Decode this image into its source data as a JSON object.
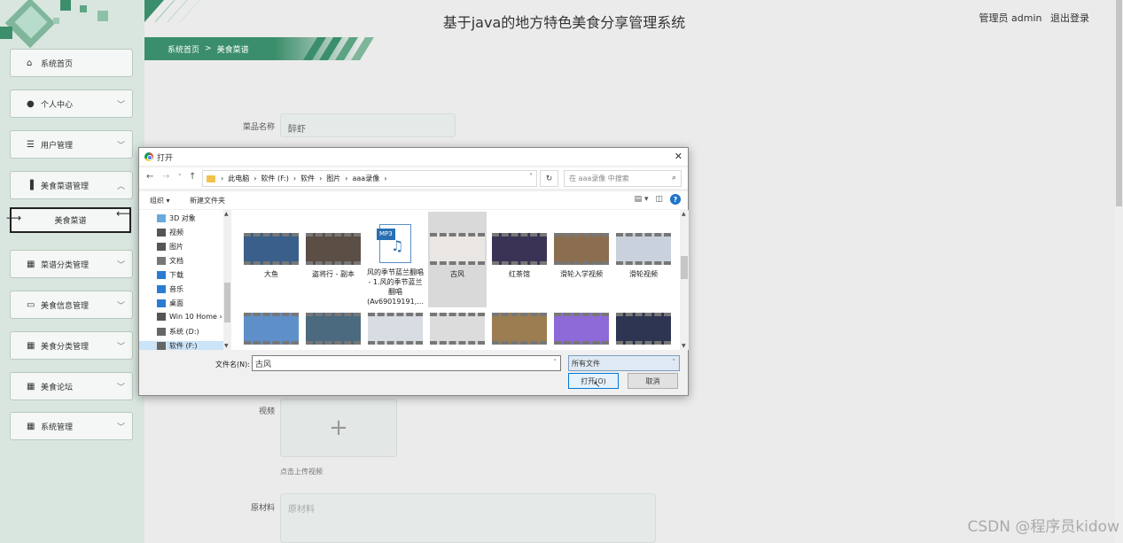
{
  "app": {
    "title": "基于java的地方特色美食分享管理系统",
    "user_role_text": "管理员 admin",
    "logout_label": "退出登录"
  },
  "breadcrumb": {
    "home": "系统首页",
    "separator": ">",
    "current": "美食菜谱"
  },
  "sidebar": {
    "items": [
      {
        "label": "系统首页",
        "icon": "home-icon"
      },
      {
        "label": "个人中心",
        "icon": "user-icon"
      },
      {
        "label": "用户管理",
        "icon": "list-icon"
      },
      {
        "label": "美食菜谱管理",
        "icon": "bar-chart-icon"
      },
      {
        "label": "菜谱分类管理",
        "icon": "grid-icon"
      },
      {
        "label": "美食信息管理",
        "icon": "monitor-icon"
      },
      {
        "label": "美食分类管理",
        "icon": "grid-icon"
      },
      {
        "label": "美食论坛",
        "icon": "grid-icon"
      },
      {
        "label": "系统管理",
        "icon": "grid-icon"
      }
    ],
    "sub_item": "美食菜谱"
  },
  "form": {
    "dish_name_label": "菜品名称",
    "dish_name_value": "醉虾",
    "video_label": "视频",
    "upload_hint": "点击上传视频",
    "ingredients_label": "原材料",
    "ingredients_placeholder": "原材料"
  },
  "dialog": {
    "title": "打开",
    "path": [
      "此电脑",
      "软件 (F:)",
      "软件",
      "图片",
      "aaa录像"
    ],
    "search_placeholder": "在 aaa录像 中搜索",
    "organize": "组织 ▾",
    "new_folder": "新建文件夹",
    "tree": [
      {
        "label": "3D 对象",
        "color": "#6aa9de"
      },
      {
        "label": "视频",
        "color": "#555555"
      },
      {
        "label": "图片",
        "color": "#555555"
      },
      {
        "label": "文档",
        "color": "#777777"
      },
      {
        "label": "下载",
        "color": "#2a7cd3"
      },
      {
        "label": "音乐",
        "color": "#2a7cd3"
      },
      {
        "label": "桌面",
        "color": "#2a7cd3"
      },
      {
        "label": "Win 10 Home ›",
        "color": "#555555"
      },
      {
        "label": "系统 (D:)",
        "color": "#666666"
      },
      {
        "label": "软件 (F:)",
        "color": "#666666"
      }
    ],
    "files": [
      {
        "name": "大鱼",
        "kind": "video",
        "tint": "#3a5f8a"
      },
      {
        "name": "盗将行 - 副本",
        "kind": "video",
        "tint": "#5b4e45"
      },
      {
        "name": "风的季节蓝兰翻唱 - 1.风的季节蓝兰翻唱(Av69019191,...",
        "kind": "mp3",
        "tint": ""
      },
      {
        "name": "古风",
        "kind": "video",
        "tint": "#e9e6e3"
      },
      {
        "name": "红茶馆",
        "kind": "video",
        "tint": "#3b3356"
      },
      {
        "name": "滑轮入学视频",
        "kind": "video",
        "tint": "#8b6e4f"
      },
      {
        "name": "滑轮视频",
        "kind": "video",
        "tint": "#c9d2dc"
      },
      {
        "name": "",
        "kind": "video",
        "tint": "#5f8fc9"
      },
      {
        "name": "",
        "kind": "video",
        "tint": "#4b6a7f"
      },
      {
        "name": "",
        "kind": "video",
        "tint": "#d8dde3"
      },
      {
        "name": "",
        "kind": "video",
        "tint": "#dcdcdc"
      },
      {
        "name": "",
        "kind": "video",
        "tint": "#9c7d51"
      },
      {
        "name": "",
        "kind": "video",
        "tint": "#8d6ad8"
      },
      {
        "name": "",
        "kind": "video",
        "tint": "#2d3552"
      }
    ],
    "filename_label": "文件名(N):",
    "filename_value": "古风",
    "filetype_value": "所有文件",
    "open_label": "打开(O)",
    "cancel_label": "取消"
  },
  "watermark": "CSDN @程序员kidow"
}
